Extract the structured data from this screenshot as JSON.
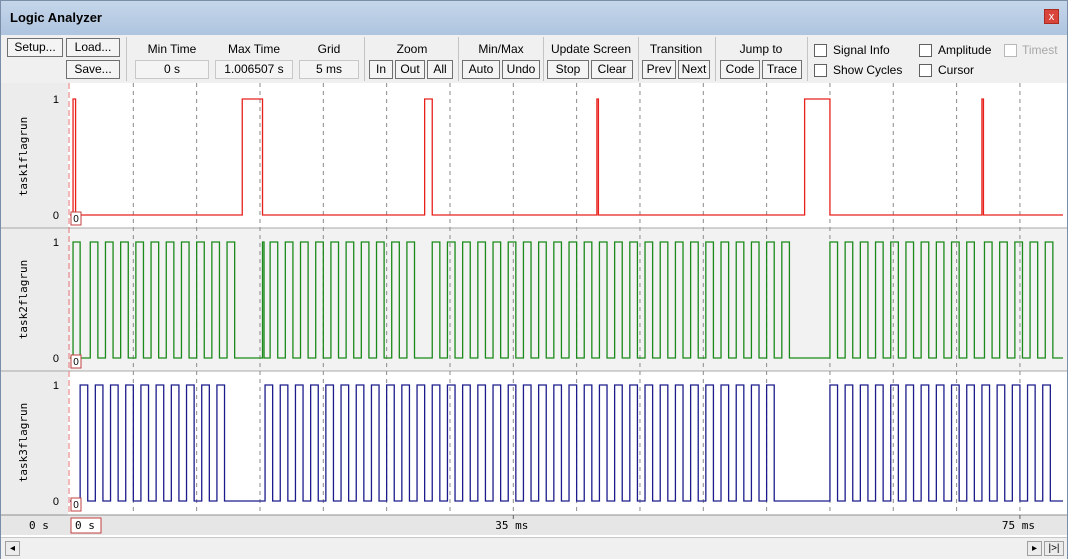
{
  "window": {
    "title": "Logic Analyzer",
    "close_glyph": "x"
  },
  "toolbar": {
    "setup": "Setup...",
    "load": "Load...",
    "save": "Save...",
    "min_time": {
      "label": "Min Time",
      "value": "0 s"
    },
    "max_time": {
      "label": "Max Time",
      "value": "1.006507 s"
    },
    "grid": {
      "label": "Grid",
      "value": "5 ms"
    },
    "zoom": {
      "label": "Zoom",
      "in": "In",
      "out": "Out",
      "all": "All"
    },
    "minmax": {
      "label": "Min/Max",
      "auto": "Auto",
      "undo": "Undo"
    },
    "update": {
      "label": "Update Screen",
      "stop": "Stop",
      "clear": "Clear"
    },
    "transition": {
      "label": "Transition",
      "prev": "Prev",
      "next": "Next"
    },
    "jump": {
      "label": "Jump to",
      "code": "Code",
      "trace": "Trace"
    },
    "checkboxes": {
      "signal_info": "Signal Info",
      "amplitude": "Amplitude",
      "timestamp": "Timest",
      "show_cycles": "Show Cycles",
      "cursor": "Cursor"
    }
  },
  "signals": [
    {
      "name": "task1flagrun",
      "high_label": "1",
      "low_label": "0",
      "marker": "0",
      "color": "#e8201c",
      "segments": [
        [
          0.6,
          1.1
        ],
        [
          34,
          38
        ],
        [
          70,
          71.5
        ],
        [
          104,
          104.3
        ],
        [
          145,
          150
        ],
        [
          180,
          180.3
        ]
      ]
    },
    {
      "name": "task2flagrun",
      "high_label": "1",
      "low_label": "0",
      "marker": "0",
      "color": "#1a8a1a",
      "segments": [
        [
          0.6,
          2
        ],
        [
          4,
          5.5
        ],
        [
          7,
          8.5
        ],
        [
          10,
          11.5
        ],
        [
          13,
          14.5
        ],
        [
          16,
          17.5
        ],
        [
          19,
          20.5
        ],
        [
          22,
          23.5
        ],
        [
          25,
          26.5
        ],
        [
          28,
          29.5
        ],
        [
          31,
          32.5
        ],
        [
          38,
          38.3
        ],
        [
          39.5,
          41
        ],
        [
          42.5,
          44
        ],
        [
          45.5,
          47
        ],
        [
          48.5,
          50
        ],
        [
          51.5,
          53
        ],
        [
          54.5,
          56
        ],
        [
          57.5,
          59
        ],
        [
          60.5,
          62
        ],
        [
          63.5,
          65
        ],
        [
          66.5,
          68
        ],
        [
          71.5,
          73
        ],
        [
          74.5,
          76
        ],
        [
          77.5,
          79
        ],
        [
          80.5,
          82
        ],
        [
          83.5,
          85
        ],
        [
          86.5,
          88
        ],
        [
          89.5,
          91
        ],
        [
          92.5,
          94
        ],
        [
          95.5,
          97
        ],
        [
          98.5,
          100
        ],
        [
          101.5,
          103
        ],
        [
          104.5,
          106
        ],
        [
          107.5,
          109
        ],
        [
          110.5,
          112
        ],
        [
          113.5,
          115
        ],
        [
          116.5,
          118
        ],
        [
          119.5,
          121
        ],
        [
          122.5,
          124
        ],
        [
          125.5,
          127
        ],
        [
          128.5,
          130
        ],
        [
          131.5,
          133
        ],
        [
          134.5,
          136
        ],
        [
          137.5,
          139
        ],
        [
          140.5,
          142
        ],
        [
          150,
          151.5
        ],
        [
          153,
          154.5
        ],
        [
          156,
          157.5
        ],
        [
          159,
          160.5
        ],
        [
          162,
          163.5
        ],
        [
          165,
          166.5
        ],
        [
          168,
          169.5
        ],
        [
          171,
          172.5
        ],
        [
          174,
          175.5
        ],
        [
          177,
          178.5
        ],
        [
          180.5,
          182
        ],
        [
          183.5,
          185
        ],
        [
          186.5,
          188
        ],
        [
          189.5,
          191
        ],
        [
          192.5,
          194
        ]
      ]
    },
    {
      "name": "task3flagrun",
      "high_label": "1",
      "low_label": "0",
      "marker": "0",
      "color": "#1c1c8c",
      "segments": [
        [
          2,
          3.5
        ],
        [
          5,
          6.5
        ],
        [
          8,
          9.5
        ],
        [
          11,
          12.5
        ],
        [
          14,
          15.5
        ],
        [
          17,
          18.5
        ],
        [
          20,
          21.5
        ],
        [
          23,
          24.5
        ],
        [
          26,
          27.5
        ],
        [
          29,
          30.5
        ],
        [
          38.5,
          40
        ],
        [
          41.5,
          43
        ],
        [
          44.5,
          46
        ],
        [
          47.5,
          49
        ],
        [
          50.5,
          52
        ],
        [
          53.5,
          55
        ],
        [
          56.5,
          58
        ],
        [
          59.5,
          61
        ],
        [
          62.5,
          64
        ],
        [
          65.5,
          67
        ],
        [
          68.5,
          70
        ],
        [
          71.5,
          73
        ],
        [
          74.5,
          76
        ],
        [
          77.5,
          79
        ],
        [
          80.5,
          82
        ],
        [
          83.5,
          85
        ],
        [
          86.5,
          88
        ],
        [
          89.5,
          91
        ],
        [
          92.5,
          94
        ],
        [
          95.5,
          97
        ],
        [
          98.5,
          100
        ],
        [
          101.5,
          103
        ],
        [
          104.5,
          106
        ],
        [
          107.5,
          109
        ],
        [
          110.5,
          112
        ],
        [
          113.5,
          115
        ],
        [
          116.5,
          118
        ],
        [
          119.5,
          121
        ],
        [
          122.5,
          124
        ],
        [
          125.5,
          127
        ],
        [
          128.5,
          130
        ],
        [
          131.5,
          133
        ],
        [
          134.5,
          136
        ],
        [
          137.5,
          139
        ],
        [
          150,
          151.5
        ],
        [
          153,
          154.5
        ],
        [
          156,
          157.5
        ],
        [
          159,
          160.5
        ],
        [
          162,
          163.5
        ],
        [
          165,
          166.5
        ],
        [
          168,
          169.5
        ],
        [
          171,
          172.5
        ],
        [
          174,
          175.5
        ],
        [
          177,
          178.5
        ],
        [
          180,
          181.5
        ],
        [
          183,
          184.5
        ],
        [
          186,
          187.5
        ],
        [
          189,
          190.5
        ],
        [
          192,
          193.5
        ]
      ]
    }
  ],
  "time_axis": {
    "origin_label": "0 s",
    "marker_label": "0 s",
    "ticks": [
      "35 ms",
      "75 ms"
    ]
  },
  "scrollbar": {
    "left_glyph": "◂",
    "right_glyph": "▸",
    "end_glyph": "|>|"
  }
}
